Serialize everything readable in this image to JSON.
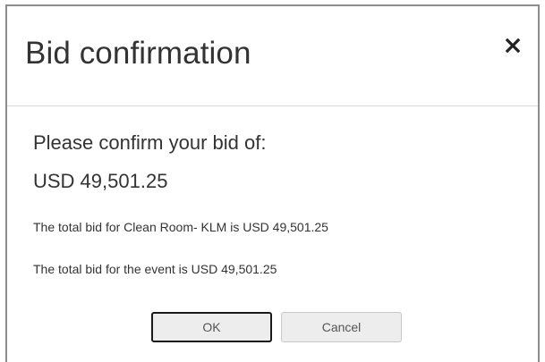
{
  "dialog": {
    "title": "Bid confirmation",
    "close_icon": "close-icon",
    "prompt": "Please confirm your bid of:",
    "amount": "USD 49,501.25",
    "line_item_total": "The total bid for Clean Room- KLM is USD 49,501.25",
    "event_total": "The total bid for the event is USD 49,501.25",
    "ok_label": "OK",
    "cancel_label": "Cancel"
  }
}
